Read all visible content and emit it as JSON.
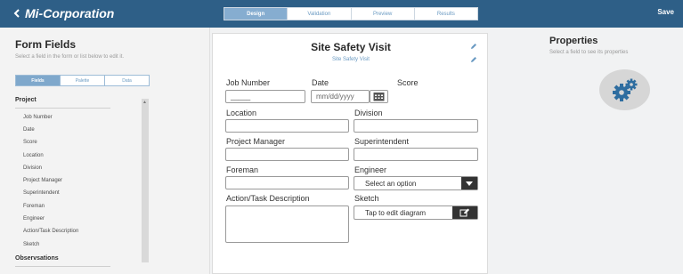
{
  "app": {
    "back_label": "Mi-Corporation",
    "save_label": "Save",
    "tabs": [
      "Design",
      "Validation",
      "Preview",
      "Results"
    ],
    "active_tab": "Design",
    "accent_color": "#2e5f87"
  },
  "left_panel": {
    "title": "Form Fields",
    "subtitle": "Select a field in the form or list below to edit it.",
    "tabs": [
      "Fields",
      "Palette",
      "Data"
    ],
    "active_tab": "Fields",
    "groups": [
      {
        "name": "Project",
        "items": [
          "Job Number",
          "Date",
          "Score",
          "Location",
          "Division",
          "Project Manager",
          "Superintendent",
          "Foreman",
          "Engineer",
          "Action/Task Description",
          "Sketch"
        ]
      },
      {
        "name": "Observsations",
        "items": []
      }
    ]
  },
  "form": {
    "title": "Site Safety Visit",
    "subtitle": "Site Safety Visit",
    "fields": {
      "job_number": {
        "label": "Job Number",
        "value": "_____"
      },
      "date": {
        "label": "Date",
        "placeholder": "mm/dd/yyyy"
      },
      "score": {
        "label": "Score"
      },
      "location": {
        "label": "Location"
      },
      "division": {
        "label": "Division"
      },
      "project_manager": {
        "label": "Project Manager"
      },
      "superintendent": {
        "label": "Superintendent"
      },
      "foreman": {
        "label": "Foreman"
      },
      "engineer": {
        "label": "Engineer",
        "value": "Select an option"
      },
      "action_task": {
        "label": "Action/Task Description"
      },
      "sketch": {
        "label": "Sketch",
        "value": "Tap to edit diagram"
      }
    }
  },
  "properties": {
    "title": "Properties",
    "subtitle": "Select a field to see its properties",
    "icon": "gears-icon"
  }
}
